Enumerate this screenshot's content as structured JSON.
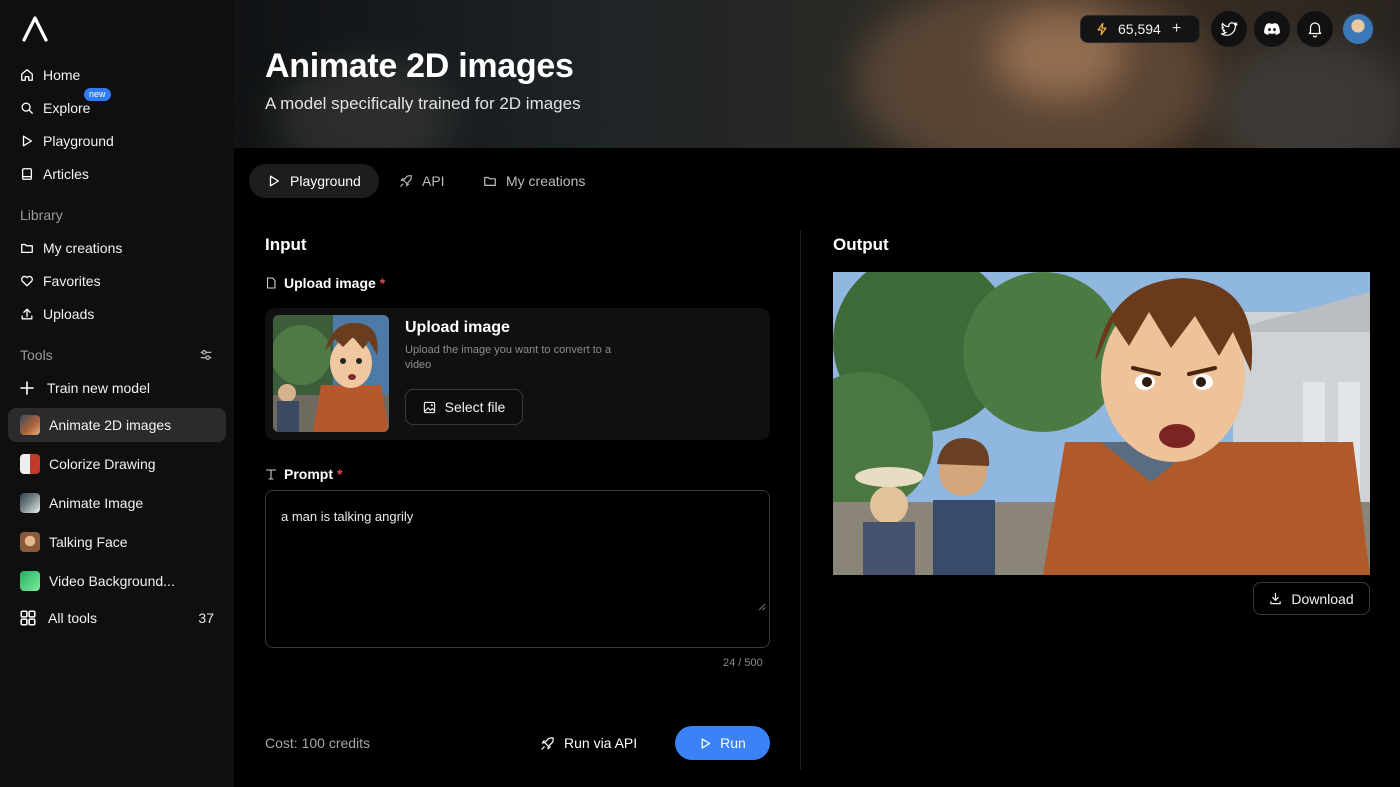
{
  "sidebar": {
    "nav": [
      {
        "label": "Home",
        "icon": "home-icon"
      },
      {
        "label": "Explore",
        "icon": "search-icon",
        "badge": "new"
      },
      {
        "label": "Playground",
        "icon": "play-icon"
      },
      {
        "label": "Articles",
        "icon": "book-icon"
      }
    ],
    "library_label": "Library",
    "library": [
      {
        "label": "My creations",
        "icon": "folder-icon"
      },
      {
        "label": "Favorites",
        "icon": "heart-icon"
      },
      {
        "label": "Uploads",
        "icon": "upload-icon"
      }
    ],
    "tools_label": "Tools",
    "train_label": "Train new model",
    "tools": [
      {
        "label": "Animate 2D images",
        "active": true
      },
      {
        "label": "Colorize Drawing"
      },
      {
        "label": "Animate Image"
      },
      {
        "label": "Talking Face"
      },
      {
        "label": "Video Background..."
      }
    ],
    "all_tools_label": "All tools",
    "all_tools_count": "37"
  },
  "header": {
    "title": "Animate 2D images",
    "subtitle": "A model specifically trained for 2D images",
    "credits": "65,594",
    "credits_plus": "+"
  },
  "tabs": [
    {
      "label": "Playground",
      "active": true
    },
    {
      "label": "API"
    },
    {
      "label": "My creations"
    }
  ],
  "input": {
    "title": "Input",
    "upload_label": "Upload image",
    "required_mark": "*",
    "upload_card_title": "Upload image",
    "upload_card_desc": "Upload the image you want to convert to a video",
    "select_file_label": "Select file",
    "prompt_label": "Prompt",
    "prompt_value": "a man is talking angrily",
    "char_count": "24 / 500",
    "cost": "Cost: 100 credits",
    "run_api_label": "Run via API",
    "run_label": "Run"
  },
  "output": {
    "title": "Output",
    "download_label": "Download"
  },
  "colors": {
    "accent": "#3b82f6",
    "required": "#e5484d",
    "badge": "#2f7cf6"
  }
}
